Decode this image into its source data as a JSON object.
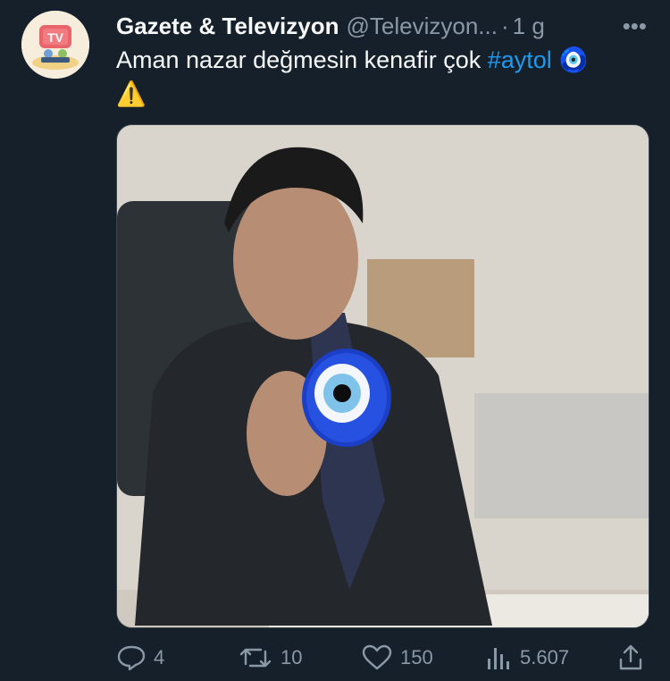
{
  "tweet": {
    "display_name": "Gazete & Televizyon",
    "handle": "@Televizyon...",
    "separator": "·",
    "time": "1 g",
    "more_label": "•••",
    "text": "Aman nazar değmesin kenafir çok ",
    "hashtag": "#aytol",
    "emoji_line1": "🧿",
    "emoji_line2": "⚠️",
    "avatar": {
      "label": "TV",
      "icon": "tv-avatar-icon"
    },
    "media": {
      "icon": "nazar-bead-icon",
      "description": ""
    }
  },
  "actions": {
    "reply_count": "4",
    "retweet_count": "10",
    "like_count": "150",
    "views_count": "5.607",
    "icons": [
      "reply-icon",
      "retweet-icon",
      "like-icon",
      "views-icon",
      "share-icon"
    ]
  },
  "colors": {
    "background": "#15202b",
    "text": "#f7f9f9",
    "muted": "#8b98a5",
    "accent": "#1d9bf0"
  }
}
